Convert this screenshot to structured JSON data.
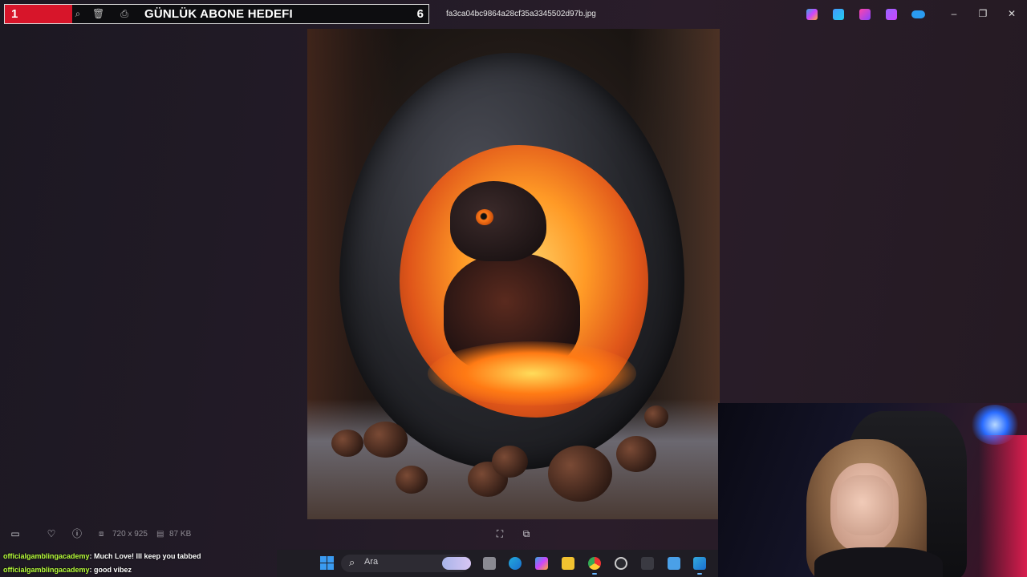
{
  "goal_bar": {
    "start": "1",
    "title": "GÜNLÜK ABONE HEDEFI",
    "end": "6",
    "progress": 0.16,
    "fill_color": "#d7152a"
  },
  "titlebar": {
    "filename": "fa3ca04bc9864a28cf35a3345502d97b.jpg",
    "toolbar_icons": [
      "zoom-icon",
      "delete-icon",
      "print-icon"
    ],
    "app_icons": [
      "copilot-icon",
      "edit-icon",
      "designer-icon",
      "clipchamp-icon",
      "onedrive-icon"
    ],
    "window_controls": [
      "minimize-icon",
      "restore-icon",
      "close-icon"
    ]
  },
  "viewer": {
    "dimensions": "720 x 925",
    "file_size": "87 KB",
    "icons": [
      "filmstrip-icon",
      "favorite-icon",
      "info-icon",
      "fit-icon",
      "crop-icon"
    ]
  },
  "chat": [
    {
      "user": "officialgamblingacademy",
      "message": ": Much Love! Ill keep you tabbed"
    },
    {
      "user": "officialgamblingacademy",
      "message": ": good vibez"
    }
  ],
  "taskbar": {
    "search_placeholder": "Ara",
    "apps": [
      "task-view-icon",
      "edge-icon",
      "copilot-app-icon",
      "file-explorer-icon",
      "chrome-icon",
      "settings-app-icon",
      "terminal-icon",
      "notepad-icon",
      "photos-icon"
    ]
  }
}
